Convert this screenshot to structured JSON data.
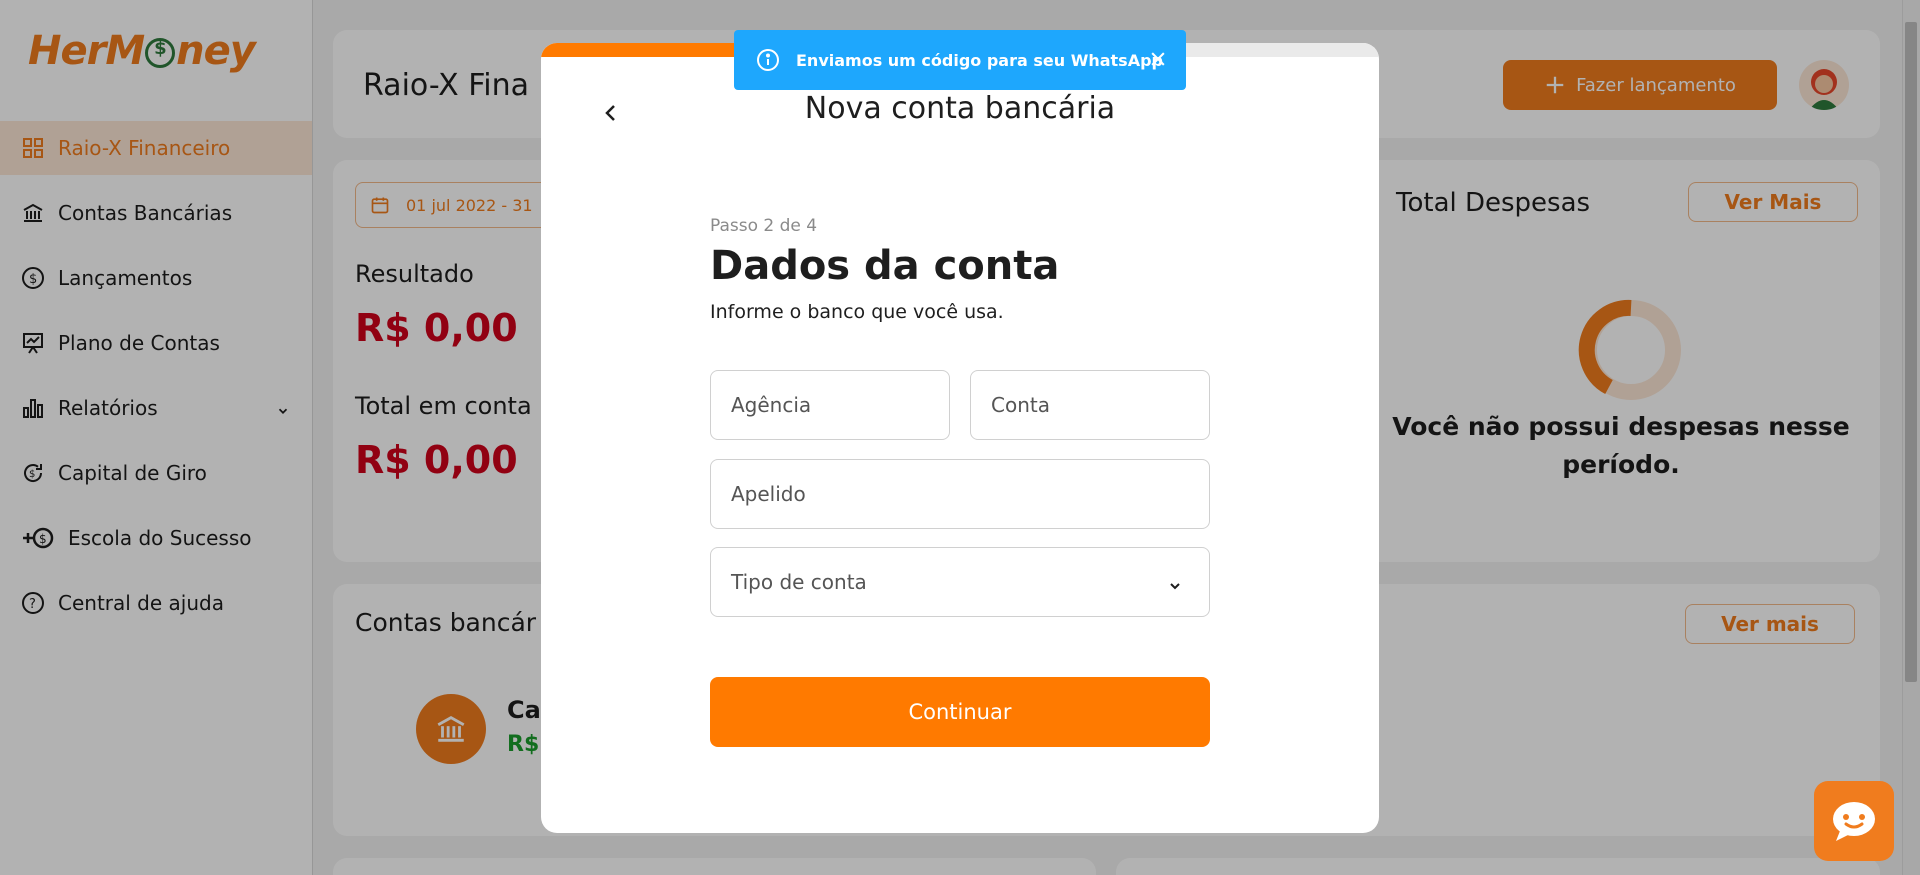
{
  "app": {
    "logo_text": "HerMoney"
  },
  "sidebar": {
    "items": [
      {
        "label": "Raio-X Financeiro",
        "icon": "dashboard-icon",
        "active": true
      },
      {
        "label": "Contas Bancárias",
        "icon": "bank-icon"
      },
      {
        "label": "Lançamentos",
        "icon": "dollar-circle-icon"
      },
      {
        "label": "Plano de Contas",
        "icon": "presentation-icon"
      },
      {
        "label": "Relatórios",
        "icon": "bar-chart-icon"
      },
      {
        "label": "Capital de Giro",
        "icon": "refresh-dollar-icon"
      },
      {
        "label": "Escola do Sucesso",
        "icon": "plus-coin-icon"
      },
      {
        "label": "Central de ajuda",
        "icon": "help-circle-icon"
      }
    ]
  },
  "header": {
    "title": "Raio-X Fina",
    "add_button": "Fazer lançamento"
  },
  "summary": {
    "date_range": "01 jul 2022 - 31",
    "result_label": "Resultado",
    "result_value": "R$ 0,00",
    "total_label": "Total em conta",
    "total_value": "R$ 0,00"
  },
  "expenses": {
    "title": "Total Despesas",
    "more_button": "Ver Mais",
    "empty_message": "Você não possui despesas nesse período."
  },
  "accounts": {
    "title": "Contas bancár",
    "more_button": "Ver mais",
    "bank_name": "Ca",
    "bank_value": "R$"
  },
  "toast": {
    "message": "Enviamos um código para seu WhatsApp"
  },
  "modal": {
    "title": "Nova conta bancária",
    "progress": 0.25,
    "step": "Passo 2 de 4",
    "form_title": "Dados da conta",
    "form_subtitle": "Informe o banco que você usa.",
    "fields": {
      "agency_placeholder": "Agência",
      "account_placeholder": "Conta",
      "nickname_placeholder": "Apelido",
      "type_placeholder": "Tipo de conta"
    },
    "continue_button": "Continuar"
  },
  "colors": {
    "accent": "#f07c1e",
    "cta": "#ff7a00",
    "negative": "#d0021b",
    "positive": "#1a9c2b",
    "toast": "#1ea7fd"
  }
}
